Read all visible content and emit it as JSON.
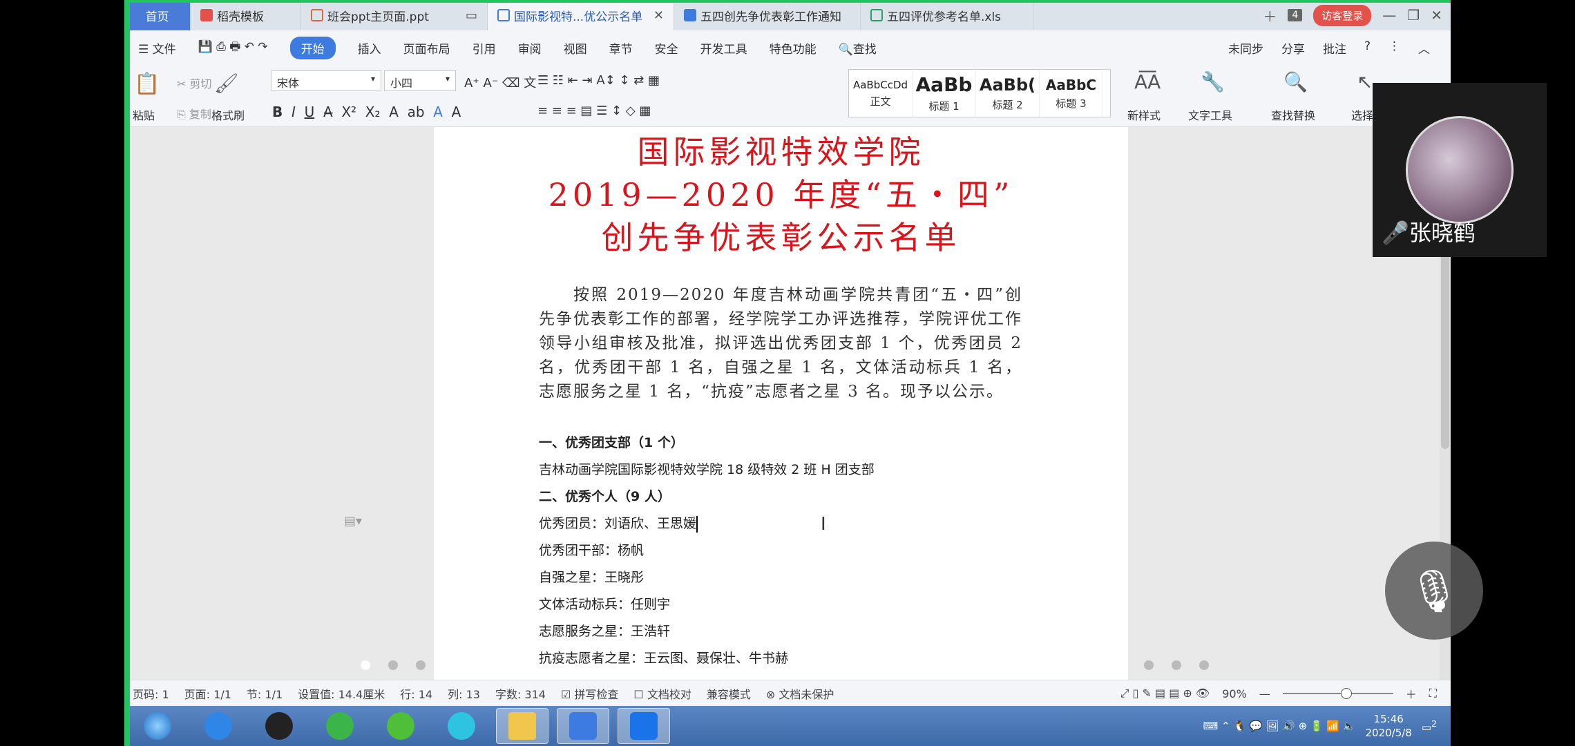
{
  "colors": {
    "accent": "#3d7be0",
    "green": "#22c55e",
    "title_red": "#d9151c",
    "login_red": "#e2524b"
  },
  "tabs": [
    {
      "label": "首页",
      "icon": ""
    },
    {
      "label": "稻壳模板",
      "icon": "docer-icon"
    },
    {
      "label": "班会ppt主页面.ppt",
      "icon": "ppt-icon"
    },
    {
      "label": "国际影视特...优公示名单",
      "icon": "word-icon"
    },
    {
      "label": "五四创先争优表彰工作通知",
      "icon": "word-icon"
    },
    {
      "label": "五四评优参考名单.xls",
      "icon": "excel-icon"
    }
  ],
  "tab_count": "4",
  "login_label": "访客登录",
  "menu": {
    "file": "文件",
    "items": [
      "开始",
      "插入",
      "页面布局",
      "引用",
      "审阅",
      "视图",
      "章节",
      "安全",
      "开发工具",
      "特色功能"
    ],
    "search": "查找",
    "right": [
      "未同步",
      "分享",
      "批注"
    ]
  },
  "ribbon": {
    "paste": "粘贴",
    "cut": "剪切",
    "copy": "复制",
    "format_painter": "格式刷",
    "font_name": "宋体",
    "font_size": "小四",
    "styles": [
      {
        "sample": "AaBbCcDd",
        "name": "正文"
      },
      {
        "sample": "AaBb",
        "name": "标题 1"
      },
      {
        "sample": "AaBb(",
        "name": "标题 2"
      },
      {
        "sample": "AaBbC",
        "name": "标题 3"
      }
    ],
    "new_style": "新样式",
    "text_tools": "文字工具",
    "find_replace": "查找替换",
    "select": "选择"
  },
  "doc": {
    "title1": "国际影视特效学院",
    "title2": "2019—2020 年度“五・四”",
    "title3": "创先争优表彰公示名单",
    "paragraph": "按照 2019—2020 年度吉林动画学院共青团“五・四”创先争优表彰工作的部署，经学院学工办评选推荐，学院评优工作领导小组审核及批准，拟评选出优秀团支部 1 个，优秀团员 2 名，优秀团干部 1 名，自强之星 1 名，文体活动标兵 1 名，志愿服务之星 1 名，“抗疫”志愿者之星 3 名。现予以公示。",
    "heading1": "一、优秀团支部（1 个）",
    "branch": "吉林动画学院国际影视特效学院 18 级特效 2 班 H 团支部",
    "heading2": "二、优秀个人（9 人）",
    "rows": [
      "优秀团员：刘语欣、王思媛",
      "优秀团干部：杨帆",
      "自强之星：王晓彤",
      "文体活动标兵：任则宇",
      "志愿服务之星：王浩轩",
      "抗疫志愿者之星：王云图、聂保壮、牛书赫"
    ]
  },
  "status": {
    "page_code": "页码: 1",
    "page": "页面: 1/1",
    "section": "节: 1/1",
    "setting": "设置值: 14.4厘米",
    "row": "行: 14",
    "col": "列: 13",
    "words": "字数: 314",
    "spell": "拼写检查",
    "doc_check": "文档校对",
    "compat": "兼容模式",
    "protect": "文档未保护",
    "zoom": "90%"
  },
  "taskbar": {
    "time": "15:46",
    "date": "2020/5/8",
    "notif": "2"
  },
  "video": {
    "name": "张晓鹤"
  }
}
